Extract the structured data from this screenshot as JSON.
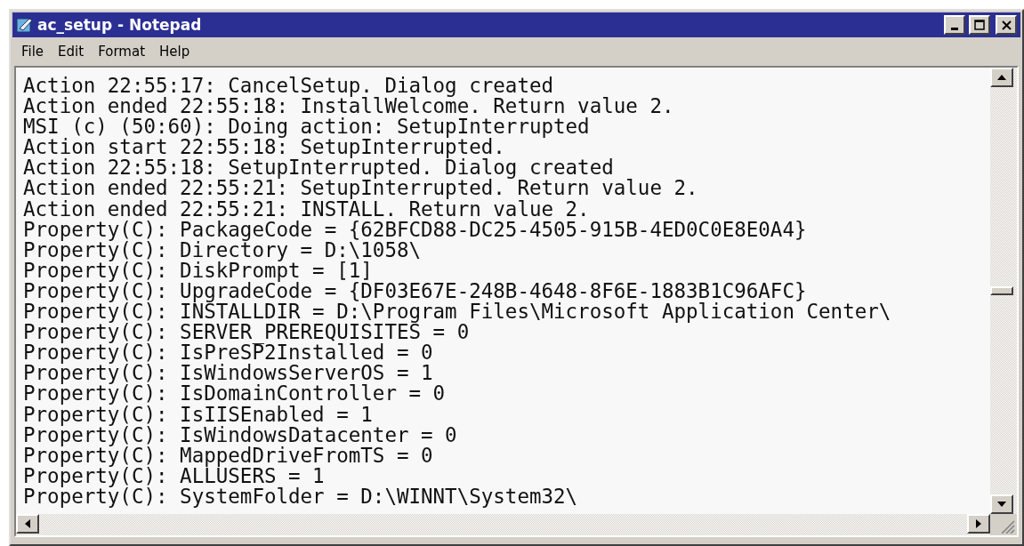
{
  "window": {
    "title": "ac_setup - Notepad"
  },
  "menu": [
    "File",
    "Edit",
    "Format",
    "Help"
  ],
  "lines": [
    "Action 22:55:17: CancelSetup. Dialog created",
    "Action ended 22:55:18: InstallWelcome. Return value 2.",
    "MSI (c) (50:60): Doing action: SetupInterrupted",
    "Action start 22:55:18: SetupInterrupted.",
    "Action 22:55:18: SetupInterrupted. Dialog created",
    "Action ended 22:55:21: SetupInterrupted. Return value 2.",
    "Action ended 22:55:21: INSTALL. Return value 2.",
    "Property(C): PackageCode = {62BFCD88-DC25-4505-915B-4ED0C0E8E0A4}",
    "Property(C): Directory = D:\\1058\\",
    "Property(C): DiskPrompt = [1]",
    "Property(C): UpgradeCode = {DF03E67E-248B-4648-8F6E-1883B1C96AFC}",
    "Property(C): INSTALLDIR = D:\\Program Files\\Microsoft Application Center\\",
    "Property(C): SERVER_PREREQUISITES = 0",
    "Property(C): IsPreSP2Installed = 0",
    "Property(C): IsWindowsServerOS = 1",
    "Property(C): IsDomainController = 0",
    "Property(C): IsIISEnabled = 1",
    "Property(C): IsWindowsDatacenter = 0",
    "Property(C): MappedDriveFromTS = 0",
    "Property(C): ALLUSERS = 1",
    "Property(C): SystemFolder = D:\\WINNT\\System32\\"
  ]
}
